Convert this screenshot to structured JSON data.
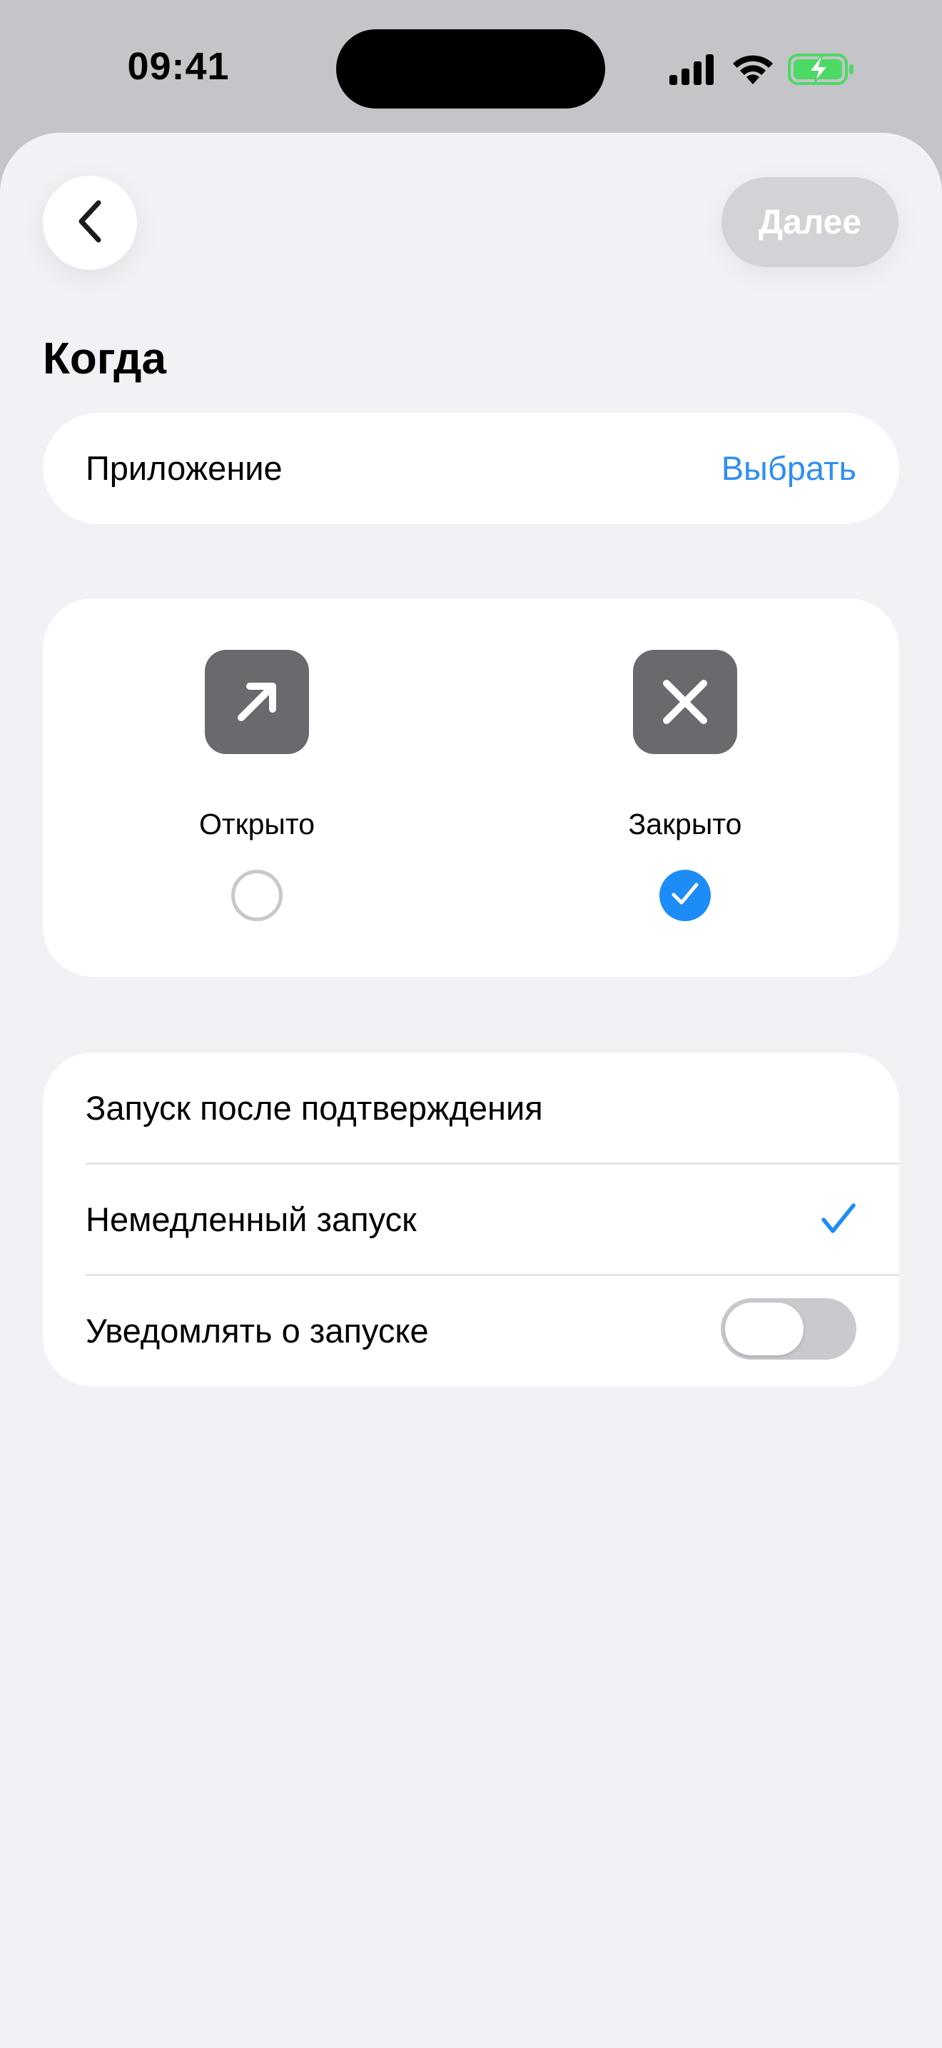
{
  "status_bar": {
    "time": "09:41",
    "icons": [
      "cellular-signal-icon",
      "wifi-icon",
      "battery-charging-icon"
    ],
    "battery_color": "#4cd964"
  },
  "nav": {
    "back_icon": "chevron-left-icon",
    "next_label": "Далее"
  },
  "section_title": "Когда",
  "app_row": {
    "label": "Приложение",
    "action": "Выбрать"
  },
  "state_options": [
    {
      "label": "Открыто",
      "icon": "arrow-up-right-icon",
      "selected": false
    },
    {
      "label": "Закрыто",
      "icon": "close-x-icon",
      "selected": true
    }
  ],
  "run_options": [
    {
      "label": "Запуск после подтверждения",
      "selected": false
    },
    {
      "label": "Немедленный запуск",
      "selected": true
    }
  ],
  "notify": {
    "label": "Уведомлять о запуске",
    "enabled": false
  },
  "colors": {
    "accent": "#1d8cf6",
    "link": "#2f8ef4",
    "icon_tile": "#6a6a6e",
    "background": "#f1f1f6"
  }
}
